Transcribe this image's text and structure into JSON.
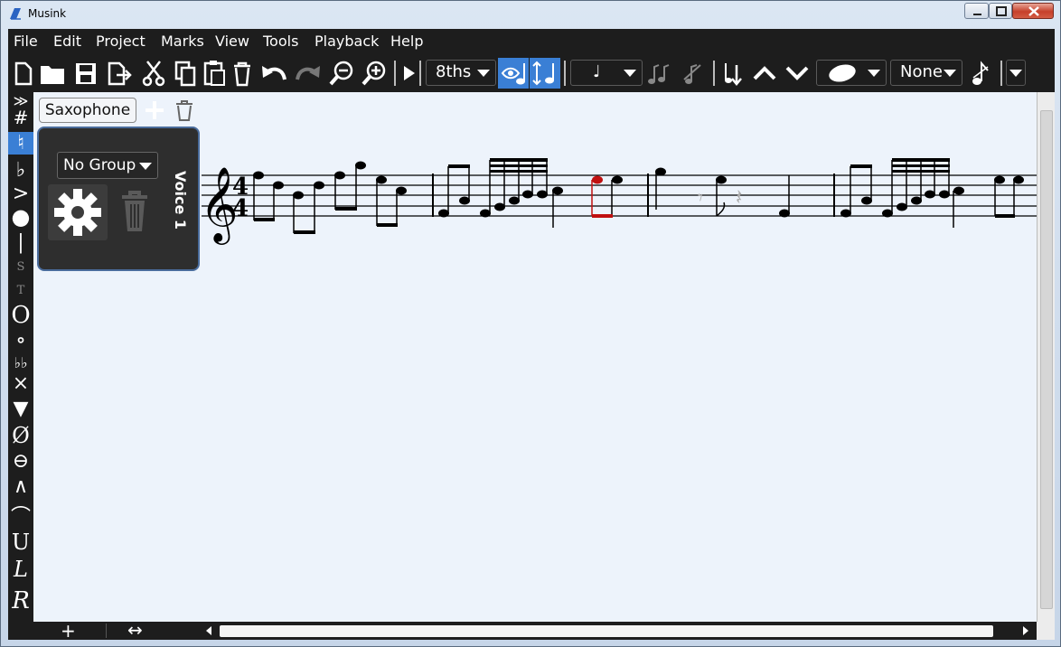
{
  "window": {
    "title": "Musink"
  },
  "menu": [
    "File",
    "Edit",
    "Project",
    "Marks",
    "View",
    "Tools",
    "Playback",
    "Help"
  ],
  "toolbar": {
    "snap_value": "8ths",
    "note_value": "♩",
    "head_value": "None",
    "icons": [
      "new-file-icon",
      "open-folder-icon",
      "save-icon",
      "export-icon",
      "cut-icon",
      "copy-icon",
      "paste-icon",
      "delete-icon",
      "undo-icon",
      "redo-icon",
      "zoom-out-icon",
      "zoom-in-icon",
      "play-icon",
      "show-hidden-icon",
      "pitch-shift-icon",
      "tuplet-icon",
      "split-notes-icon",
      "stem-flip-icon",
      "slur-up-icon",
      "slur-down-icon",
      "notehead-icon",
      "grace-note-icon"
    ]
  },
  "palette": [
    "≫",
    "#",
    "♮",
    "♭",
    ">",
    "●",
    "|",
    "S",
    "T",
    "O",
    "∘",
    "♭♭",
    "×",
    "▼",
    "Ø",
    "⊖",
    "∧",
    "⌒",
    "U",
    "L",
    "R"
  ],
  "panel": {
    "tab_label": "Saxophone",
    "group_label": "No Group",
    "voice_label": "Voice 1"
  },
  "score": {
    "time_signature": [
      "4",
      "4"
    ],
    "measures": 5
  },
  "bottom": {
    "add_label": "+",
    "resize_label": "↔"
  }
}
